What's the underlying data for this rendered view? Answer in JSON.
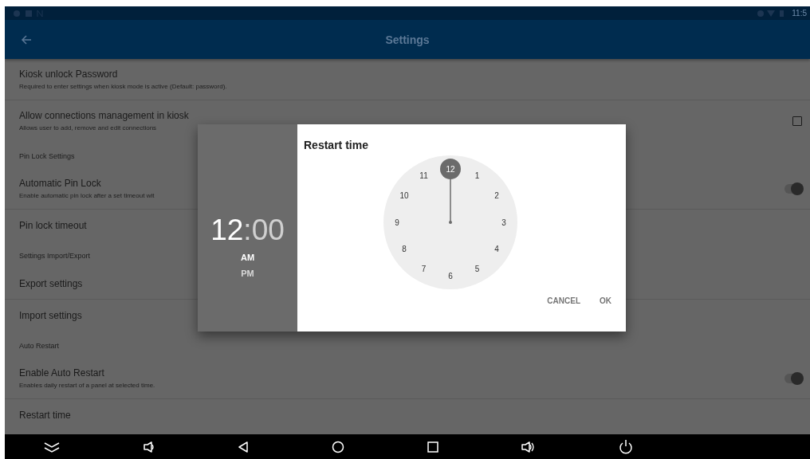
{
  "status_bar": {
    "time": "11:5"
  },
  "app_bar": {
    "title": "Settings"
  },
  "settings": [
    {
      "kind": "text",
      "title": "Kiosk unlock Password",
      "summary": "Required to enter settings when kiosk mode is active (Default: password)."
    },
    {
      "kind": "checkbox",
      "title": "Allow connections management in kiosk",
      "summary": "Allows user to add, remove and edit connections",
      "checked": false
    },
    {
      "kind": "category",
      "title": "Pin Lock Settings"
    },
    {
      "kind": "switch",
      "title": "Automatic Pin Lock",
      "summary": "Enable automatic pin lock after a set timeout wit",
      "checked": true
    },
    {
      "kind": "text",
      "title": "Pin lock timeout"
    },
    {
      "kind": "category",
      "title": "Settings Import/Export"
    },
    {
      "kind": "text",
      "title": "Export settings"
    },
    {
      "kind": "text",
      "title": "Import settings"
    },
    {
      "kind": "category",
      "title": "Auto Restart"
    },
    {
      "kind": "switch",
      "title": "Enable Auto Restart",
      "summary": "Enables daily restart of a panel at selected time.",
      "checked": true
    },
    {
      "kind": "text",
      "title": "Restart time"
    }
  ],
  "dialog": {
    "title": "Restart time",
    "hour": "12",
    "minutes": ":00",
    "periods": [
      {
        "label": "AM",
        "selected": true
      },
      {
        "label": "PM",
        "selected": false
      }
    ],
    "dial": [
      {
        "label": "12",
        "selected": true
      },
      {
        "label": "1",
        "selected": false
      },
      {
        "label": "2",
        "selected": false
      },
      {
        "label": "3",
        "selected": false
      },
      {
        "label": "4",
        "selected": false
      },
      {
        "label": "5",
        "selected": false
      },
      {
        "label": "6",
        "selected": false
      },
      {
        "label": "7",
        "selected": false
      },
      {
        "label": "8",
        "selected": false
      },
      {
        "label": "9",
        "selected": false
      },
      {
        "label": "10",
        "selected": false
      },
      {
        "label": "11",
        "selected": false
      }
    ],
    "buttons": [
      "CANCEL",
      "OK"
    ]
  }
}
